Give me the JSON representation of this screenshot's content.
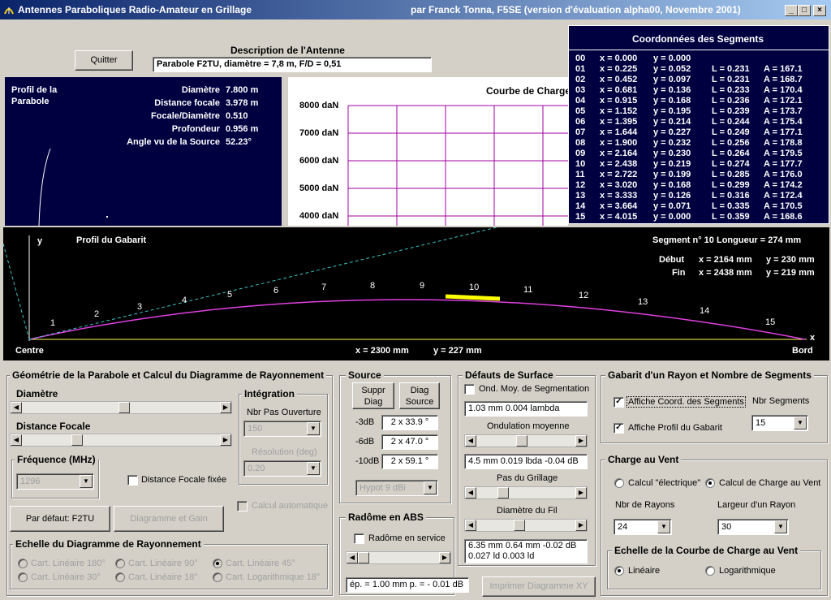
{
  "window": {
    "title": "Antennes Paraboliques Radio-Amateur en Grillage",
    "author": "par Franck Tonna, F5SE (version d'évaluation alpha00, Novembre 2001)"
  },
  "header": {
    "quit": "Quitter",
    "desc_label": "Description de l'Antenne",
    "desc_value": "Parabole F2TU, diamètre = 7,8 m, F/D = 0,51"
  },
  "profile": {
    "title1": "Profil de la",
    "title2": "Parabole",
    "rows": [
      {
        "k": "Diamètre",
        "v": "7.800 m"
      },
      {
        "k": "Distance focale",
        "v": "3.978 m"
      },
      {
        "k": "Focale/Diamètre",
        "v": "0.510"
      },
      {
        "k": "Profondeur",
        "v": "0.956 m"
      },
      {
        "k": "Angle vu de la Source",
        "v": "52.23°"
      }
    ]
  },
  "charge": {
    "title": "Courbe de Charge",
    "ticks": [
      "8000 daN",
      "7000 daN",
      "6000 daN",
      "5000 daN",
      "4000 daN"
    ]
  },
  "segments": {
    "title": "Coordonnées des Segments",
    "rows": [
      {
        "n": "00",
        "x": "x = 0.000",
        "y": "y = 0.000",
        "l": "",
        "a": ""
      },
      {
        "n": "01",
        "x": "x = 0.225",
        "y": "y = 0.052",
        "l": "L = 0.231",
        "a": "A = 167.1"
      },
      {
        "n": "02",
        "x": "x = 0.452",
        "y": "y = 0.097",
        "l": "L = 0.231",
        "a": "A = 168.7"
      },
      {
        "n": "03",
        "x": "x = 0.681",
        "y": "y = 0.136",
        "l": "L = 0.233",
        "a": "A = 170.4"
      },
      {
        "n": "04",
        "x": "x = 0.915",
        "y": "y = 0.168",
        "l": "L = 0.236",
        "a": "A = 172.1"
      },
      {
        "n": "05",
        "x": "x = 1.152",
        "y": "y = 0.195",
        "l": "L = 0.239",
        "a": "A = 173.7"
      },
      {
        "n": "06",
        "x": "x = 1.395",
        "y": "y = 0.214",
        "l": "L = 0.244",
        "a": "A = 175.4"
      },
      {
        "n": "07",
        "x": "x = 1.644",
        "y": "y = 0.227",
        "l": "L = 0.249",
        "a": "A = 177.1"
      },
      {
        "n": "08",
        "x": "x = 1.900",
        "y": "y = 0.232",
        "l": "L = 0.256",
        "a": "A = 178.8"
      },
      {
        "n": "09",
        "x": "x = 2.164",
        "y": "y = 0.230",
        "l": "L = 0.264",
        "a": "A = 179.5"
      },
      {
        "n": "10",
        "x": "x = 2.438",
        "y": "y = 0.219",
        "l": "L = 0.274",
        "a": "A = 177.7"
      },
      {
        "n": "11",
        "x": "x = 2.722",
        "y": "y = 0.199",
        "l": "L = 0.285",
        "a": "A = 176.0"
      },
      {
        "n": "12",
        "x": "x = 3.020",
        "y": "y = 0.168",
        "l": "L = 0.299",
        "a": "A = 174.2"
      },
      {
        "n": "13",
        "x": "x = 3.333",
        "y": "y = 0.126",
        "l": "L = 0.316",
        "a": "A = 172.4"
      },
      {
        "n": "14",
        "x": "x = 3.664",
        "y": "y = 0.071",
        "l": "L = 0.335",
        "a": "A = 170.5"
      },
      {
        "n": "15",
        "x": "x = 4.015",
        "y": "y = 0.000",
        "l": "L = 0.359",
        "a": "A = 168.6"
      }
    ]
  },
  "gabarit": {
    "y": "y",
    "title": "Profil du Gabarit",
    "seg": "Segment n° 10  Longueur = 274 mm",
    "debut": "Début",
    "debut_x": "x = 2164 mm",
    "debut_y": "y = 230 mm",
    "fin": "Fin",
    "fin_x": "x = 2438 mm",
    "fin_y": "y = 219 mm",
    "centre": "Centre",
    "bord": "Bord",
    "xaxis": "x",
    "cur_x": "x = 2300 mm",
    "cur_y": "y = 227 mm",
    "labels": [
      "1",
      "2",
      "3",
      "4",
      "5",
      "6",
      "7",
      "8",
      "9",
      "10",
      "11",
      "12",
      "13",
      "14",
      "15"
    ]
  },
  "geom": {
    "title": "Géométrie de la Parabole et Calcul du Diagramme de Rayonnement",
    "diametre": "Diamètre",
    "focale": "Distance Focale",
    "integration": "Intégration",
    "nbpas": "Nbr Pas Ouverture",
    "nbpas_v": "150",
    "resol": "Résolution (deg)",
    "resol_v": "0.20",
    "freq": "Fréquence (MHz)",
    "freq_v": "1296",
    "dff": "Distance Focale fixée",
    "calcauto": "Calcul automatique",
    "defaut": "Par défaut: F2TU",
    "diag": "Diagramme et Gain",
    "echelle": "Echelle du Diagramme de Rayonnement",
    "radios": [
      "Cart. Linéaire 180°",
      "Cart. Linéaire 90°",
      "Cart. Linéaire 45°",
      "Cart. Linéaire 30°",
      "Cart. Linéaire 18°",
      "Cart. Logarithmique 18°"
    ]
  },
  "source": {
    "title": "Source",
    "suppr1": "Suppr",
    "suppr2": "Diag",
    "diag1": "Diag",
    "diag2": "Source",
    "rows": [
      {
        "k": "-3dB",
        "v": "2 x 33.9 °"
      },
      {
        "k": "-6dB",
        "v": "2 x 47.0 °"
      },
      {
        "k": "-10dB",
        "v": "2 x 59.1 °"
      }
    ],
    "hypot": "Hypot 9 dBi"
  },
  "radome": {
    "title": "Radôme en ABS",
    "chk": "Radôme en service",
    "val": "ép. = 1.00 mm  p. = - 0.01 dB"
  },
  "defauts": {
    "title": "Défauts de Surface",
    "ond": "Ond. Moy. de Segmentation",
    "v1": "1.03 mm   0.004 lambda",
    "ondmoy": "Ondulation moyenne",
    "v2": "4.5 mm  0.019 lbda  -0.04 dB",
    "pas": "Pas du Grillage",
    "fil": "Diamètre du Fil",
    "v3a": "6.35 mm   0.64 mm    -0.02 dB",
    "v3b": "0.027 ld    0.003 ld",
    "imprimer": "Imprimer Diagramme XY"
  },
  "gab": {
    "title": "Gabarit d'un Rayon et Nombre de Segments",
    "c1": "Affiche Coord. des Segments",
    "c2": "Affiche Profil du Gabarit",
    "nbseg": "Nbr Segments",
    "nbseg_v": "15"
  },
  "vent": {
    "title": "Charge au Vent",
    "r1": "Calcul \"électrique\"",
    "r2": "Calcul de Charge au Vent",
    "nbr": "Nbr de Rayons",
    "nbr_v": "24",
    "larg": "Largeur d'un Rayon",
    "larg_v": "30",
    "echelle": "Echelle de la Courbe de Charge au Vent",
    "lin": "Linéaire",
    "log": "Logarithmique"
  }
}
